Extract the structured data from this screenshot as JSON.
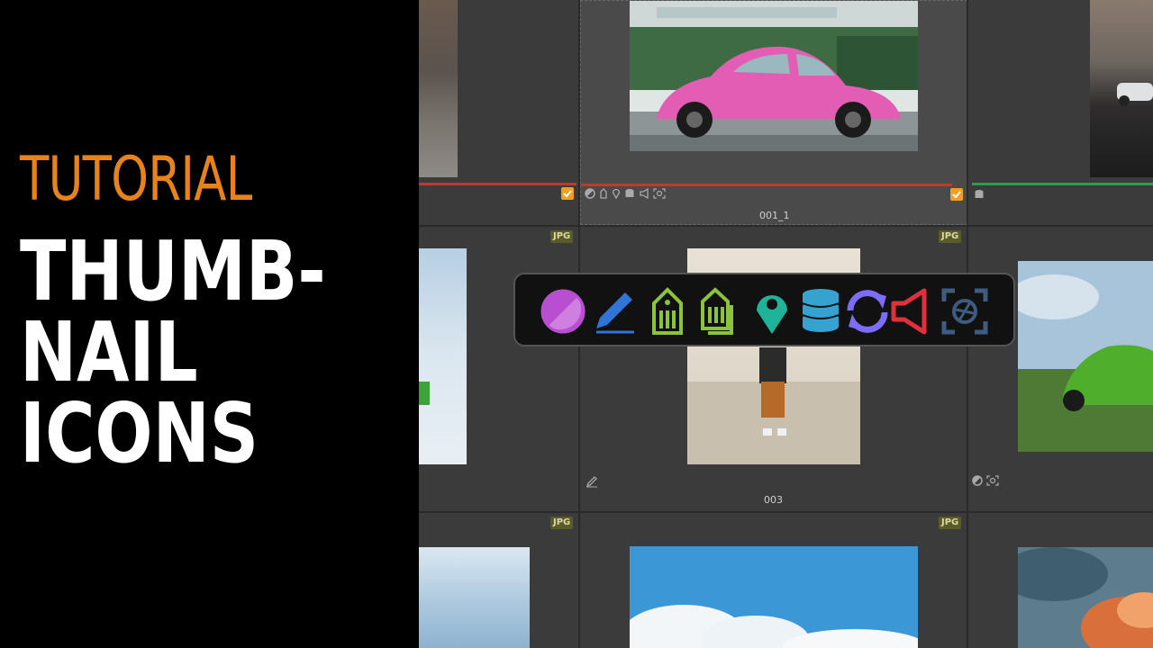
{
  "title": {
    "line1": "TUTORIAL",
    "line2": "THUMB-",
    "line3": "NAIL",
    "line4": "ICONS"
  },
  "colors": {
    "title_accent": "#e8831c",
    "check": "#f2a01e",
    "label_red": "#c0392b",
    "label_green": "#27a052",
    "icon_develop": "#b84fd1",
    "icon_edit": "#2f74d6",
    "icon_tag": "#8bc43a",
    "icon_gps": "#1fb39a",
    "icon_database": "#36a2d0",
    "icon_sync": "#7d6cf5",
    "icon_audio": "#e0303c",
    "icon_face": "#3d5c80"
  },
  "thumbnails": {
    "row1_center_name": "001_1",
    "row2_center_name": "003",
    "badge": "JPG"
  },
  "overlay_icons": [
    "develop-icon",
    "edit-pencil-icon",
    "tag-icon",
    "tag-copies-icon",
    "gps-pin-icon",
    "database-icon",
    "sync-icon",
    "audio-speaker-icon",
    "face-detect-icon"
  ]
}
